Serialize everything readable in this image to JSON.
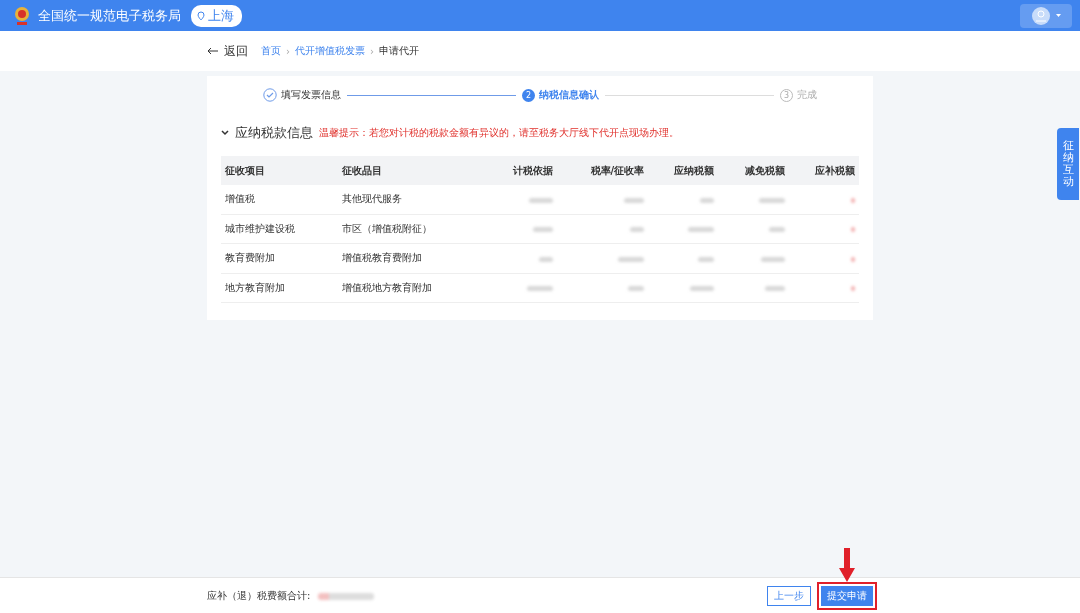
{
  "header": {
    "title": "全国统一规范电子税务局",
    "region": "上海"
  },
  "nav": {
    "back": "返回",
    "breadcrumb": [
      "首页",
      "代开增值税发票",
      "申请代开"
    ],
    "separator": "›"
  },
  "steps": [
    {
      "label": "填写发票信息",
      "completed": true,
      "selected": false
    },
    {
      "number": "2",
      "label": "纳税信息确认",
      "completed": false,
      "selected": true
    },
    {
      "number": "3",
      "label": "完成",
      "completed": false,
      "selected": false
    }
  ],
  "section": {
    "title": "应纳税款信息",
    "expanded": true,
    "notice": "温馨提示：若您对计税的税款金额有异议的，请至税务大厅线下代开点现场办理。"
  },
  "table": {
    "columns": [
      {
        "label": "征收项目",
        "kind": "text"
      },
      {
        "label": "征收品目",
        "kind": "text"
      },
      {
        "label": "计税依据",
        "kind": "hidden"
      },
      {
        "label": "税率/征收率",
        "kind": "hidden"
      },
      {
        "label": "应纳税额",
        "kind": "hidden"
      },
      {
        "label": "减免税额",
        "kind": "hidden"
      },
      {
        "label": "应补税额",
        "kind": "hidden-red"
      }
    ],
    "rows": [
      [
        "增值税",
        "其他现代服务"
      ],
      [
        "城市维护建设税",
        "市区（增值税附征）"
      ],
      [
        "教育费附加",
        "增值税教育费附加"
      ],
      [
        "地方教育附加",
        "增值税地方教育附加"
      ]
    ]
  },
  "side_tab": "征纳互动",
  "footer": {
    "total_label": "应补（退）税费额合计:",
    "prev": "上一步",
    "submit": "提交申请",
    "submit_highlighted": true
  }
}
